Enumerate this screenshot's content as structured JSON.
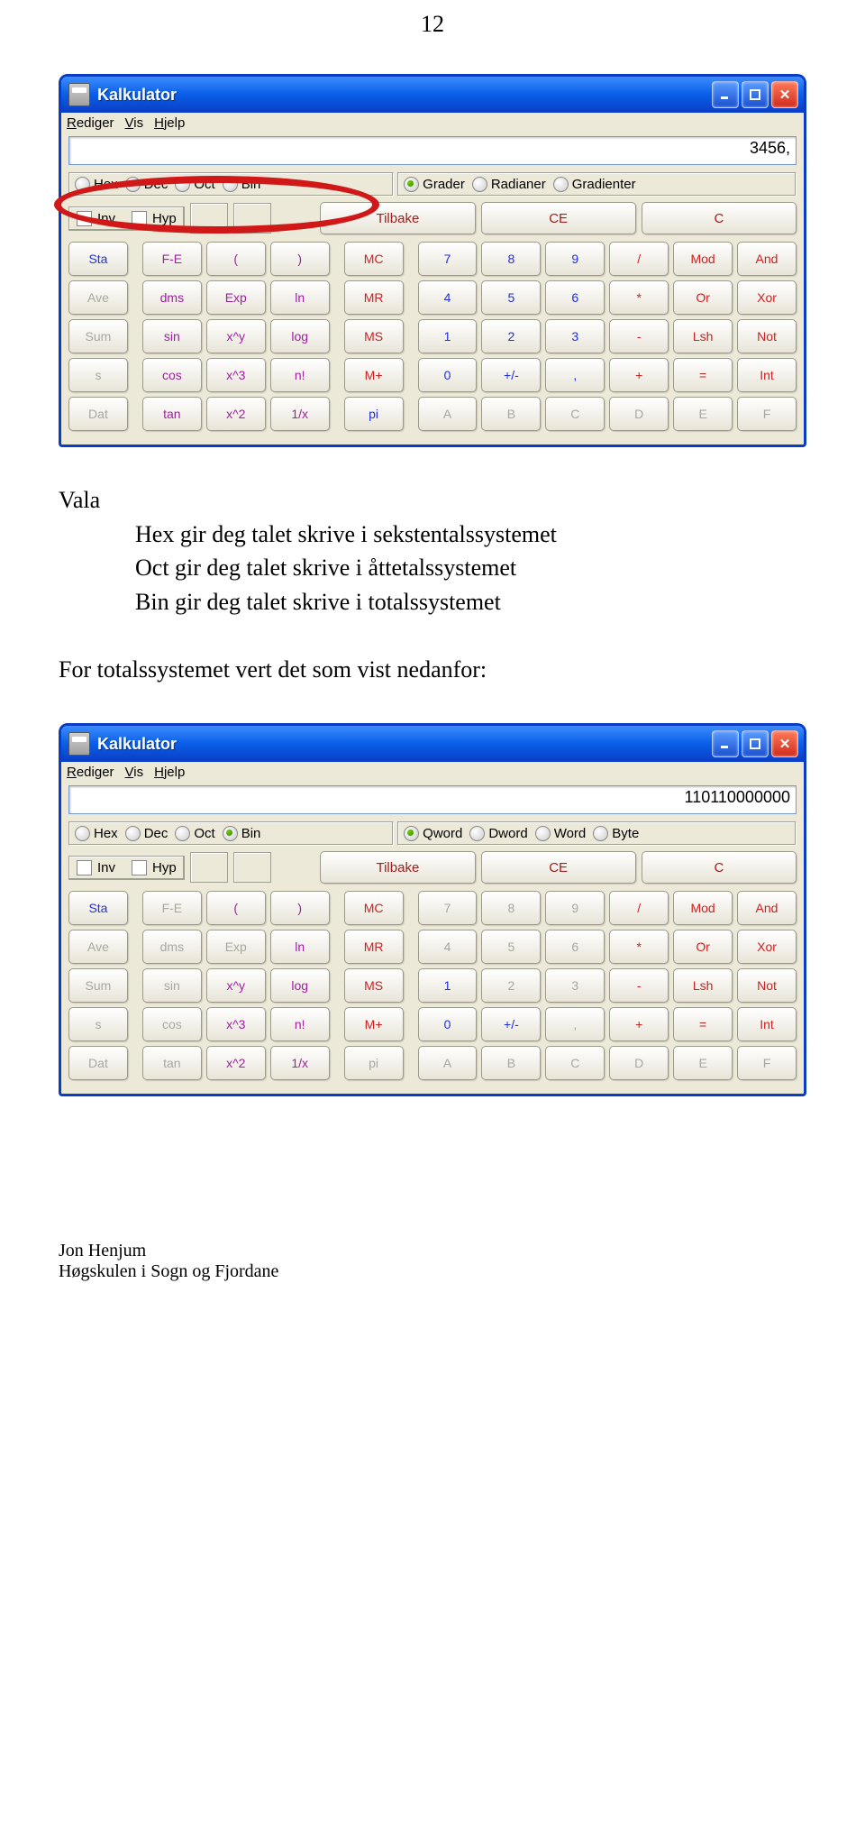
{
  "page_number": "12",
  "calc1": {
    "title": "Kalkulator",
    "menu": {
      "rediger": "Rediger",
      "vis": "Vis",
      "hjelp": "Hjelp"
    },
    "display": "3456,",
    "base_group": [
      "Hex",
      "Dec",
      "Oct",
      "Bin"
    ],
    "base_selected": 1,
    "angle_group": [
      "Grader",
      "Radianer",
      "Gradienter"
    ],
    "angle_selected": 0,
    "inv": "Inv",
    "hyp": "Hyp",
    "tilbake": "Tilbake",
    "ce": "CE",
    "c": "C"
  },
  "calc2": {
    "title": "Kalkulator",
    "menu": {
      "rediger": "Rediger",
      "vis": "Vis",
      "hjelp": "Hjelp"
    },
    "display": "110110000000",
    "base_group": [
      "Hex",
      "Dec",
      "Oct",
      "Bin"
    ],
    "base_selected": 3,
    "word_group": [
      "Qword",
      "Dword",
      "Word",
      "Byte"
    ],
    "word_selected": 0,
    "inv": "Inv",
    "hyp": "Hyp",
    "tilbake": "Tilbake",
    "ce": "CE",
    "c": "C"
  },
  "keys": {
    "row1": [
      "Sta",
      "F-E",
      "(",
      ")",
      "MC",
      "7",
      "8",
      "9",
      "/",
      "Mod",
      "And"
    ],
    "row2": [
      "Ave",
      "dms",
      "Exp",
      "ln",
      "MR",
      "4",
      "5",
      "6",
      "*",
      "Or",
      "Xor"
    ],
    "row3": [
      "Sum",
      "sin",
      "x^y",
      "log",
      "MS",
      "1",
      "2",
      "3",
      "-",
      "Lsh",
      "Not"
    ],
    "row4": [
      "s",
      "cos",
      "x^3",
      "n!",
      "M+",
      "0",
      "+/-",
      ",",
      "+",
      "=",
      "Int"
    ],
    "row5": [
      "Dat",
      "tan",
      "x^2",
      "1/x",
      "pi",
      "A",
      "B",
      "C",
      "D",
      "E",
      "F"
    ]
  },
  "text": {
    "vala": "Vala",
    "hex": "Hex gir deg talet skrive i sekstentalssystemet",
    "oct": "Oct gir deg talet skrive i åttetalssystemet",
    "bin": "Bin gir deg talet skrive i totalssystemet",
    "for_total": "For totalssystemet vert det som vist nedanfor:"
  },
  "footer": {
    "name": "Jon Henjum",
    "school": "Høgskulen i Sogn og Fjordane"
  }
}
